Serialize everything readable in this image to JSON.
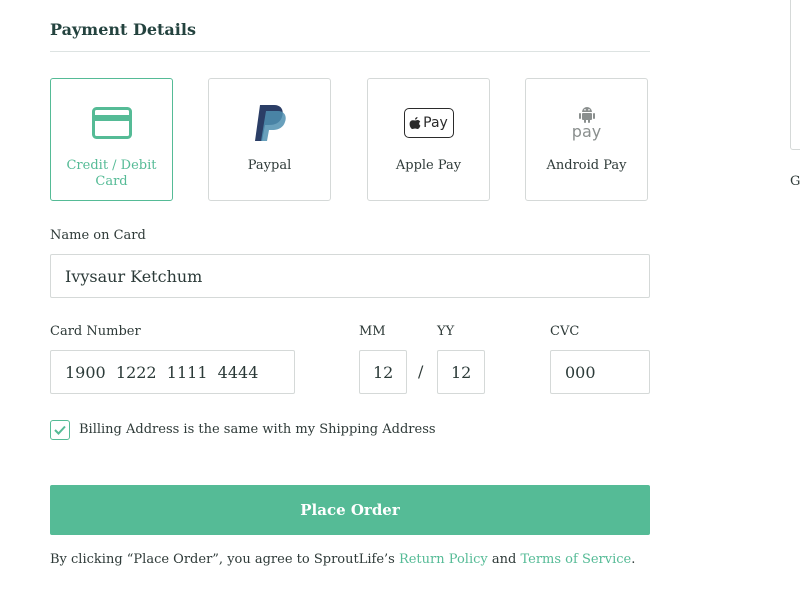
{
  "payment": {
    "title": "Payment Details",
    "methods": [
      {
        "label": "Credit / Debit Card",
        "icon": "credit-card-icon",
        "selected": true
      },
      {
        "label": "Paypal",
        "icon": "paypal-icon",
        "selected": false
      },
      {
        "label": "Apple Pay",
        "icon": "apple-pay-icon",
        "selected": false
      },
      {
        "label": "Android Pay",
        "icon": "android-pay-icon",
        "selected": false
      }
    ],
    "apple_pay_text": "Pay",
    "android_pay_text": "pay"
  },
  "form": {
    "name_label": "Name on Card",
    "name_value": "Ivysaur Ketchum",
    "card_label": "Card Number",
    "card_value": "1900  1222  1111  4444",
    "mm_label": "MM",
    "mm_value": "12",
    "yy_label": "YY",
    "yy_value": "12",
    "slash": "/",
    "cvc_label": "CVC",
    "cvc_value": "000",
    "billing_same_label": "Billing Address is the same with my Shipping Address",
    "billing_same_checked": true
  },
  "actions": {
    "place_order_label": "Place Order"
  },
  "terms": {
    "prefix": "By clicking “Place Order”, you agree to SproutLife’s ",
    "return_policy": "Return Policy",
    "and": " and ",
    "terms_of_service": "Terms of Service",
    "suffix": "."
  },
  "side": {
    "letter": "G"
  },
  "colors": {
    "accent": "#55bb96",
    "text": "#2e3a38",
    "border": "#d5d9d8",
    "heading": "#24433f"
  }
}
